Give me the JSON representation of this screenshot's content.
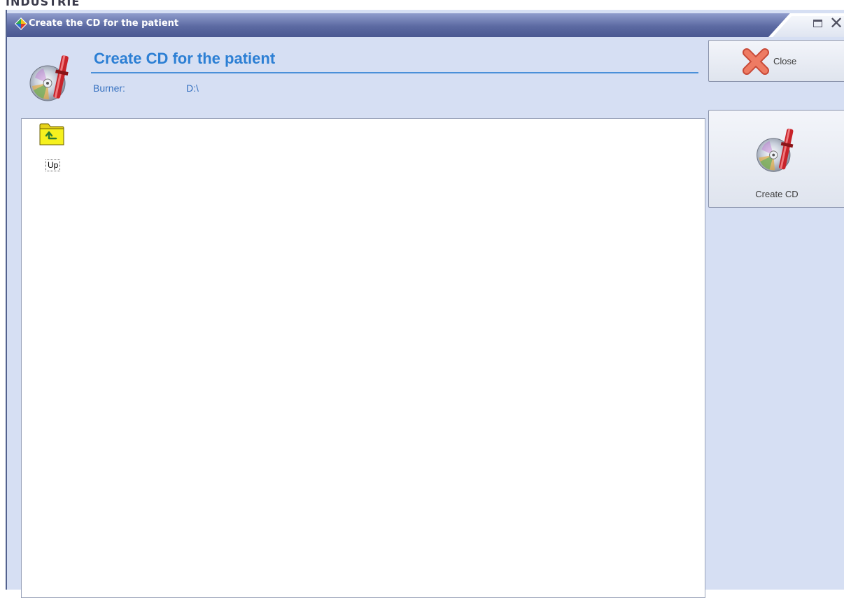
{
  "window": {
    "title": "Create the CD for the patient"
  },
  "header": {
    "title": "Create CD for the patient",
    "burner_label": "Burner:",
    "burner_value": "D:\\"
  },
  "actions": {
    "close_label": "Close",
    "create_cd_label": "Create CD"
  },
  "file_list": {
    "items": [
      {
        "label": "Up",
        "icon": "folder-up-icon"
      }
    ]
  },
  "colors": {
    "titlebar": "#5c6aa2",
    "window_background": "#d6dff3",
    "header_title": "#2c7fd4",
    "close_cross": "#e8604a"
  }
}
